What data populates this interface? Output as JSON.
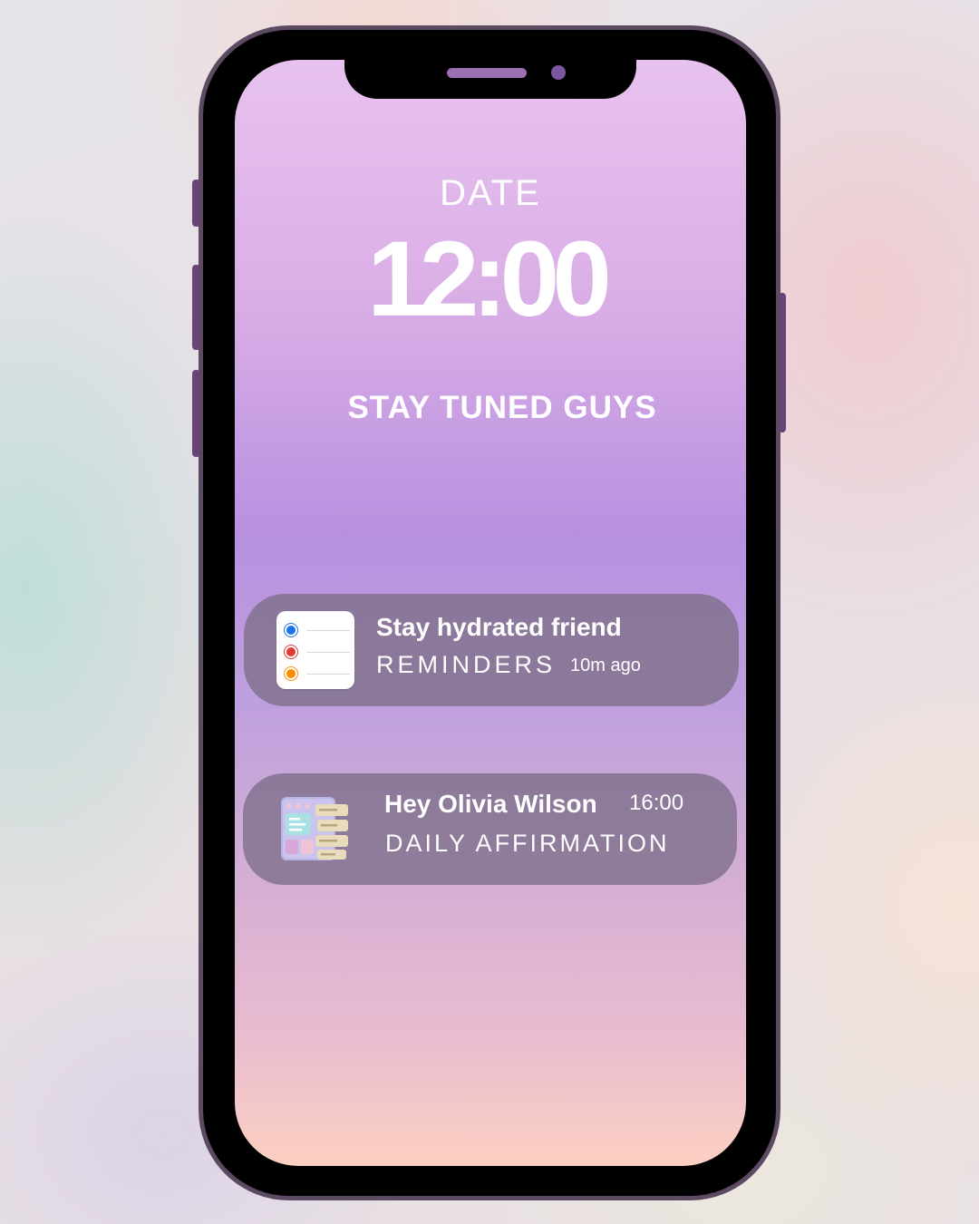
{
  "lock_screen": {
    "date_label": "DATE",
    "time": "12:00",
    "tagline": "STAY TUNED GUYS"
  },
  "notifications": [
    {
      "title": "Stay hydrated friend",
      "app_name": "REMINDERS",
      "time": "10m ago",
      "icon": "reminders-app-icon"
    },
    {
      "title": "Hey Olivia Wilson",
      "app_name": "DAILY AFFIRMATION",
      "time": "16:00",
      "icon": "dashboard-board-icon"
    }
  ],
  "colors": {
    "phone_frame": "#5b4a62",
    "screen_top": "#e8c2ee",
    "screen_mid": "#b890e0",
    "screen_bottom": "#fcd0c2",
    "notification_bg": "#80708c",
    "reminder_dots": [
      "#1a73e8",
      "#e53935",
      "#fb8c00"
    ]
  }
}
